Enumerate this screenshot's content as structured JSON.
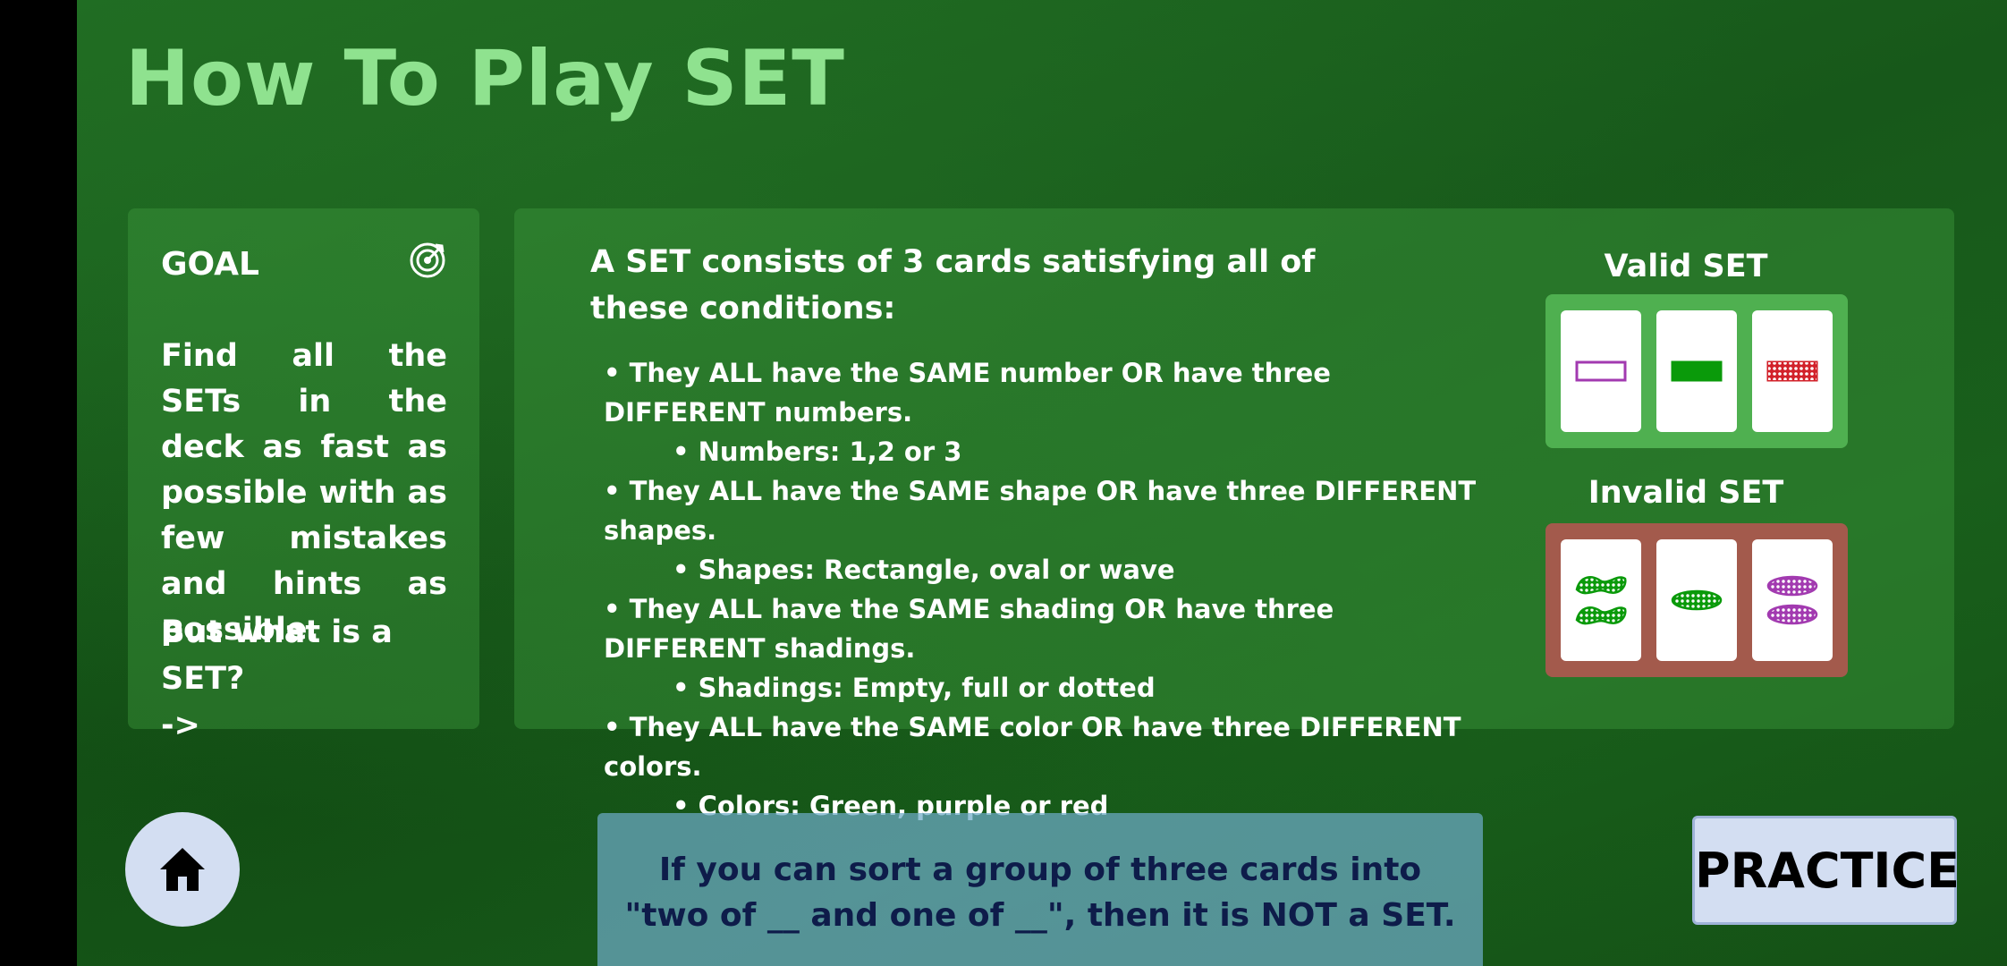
{
  "page": {
    "title": "How To Play SET"
  },
  "goal": {
    "heading": "GOAL",
    "icon": "target-icon",
    "text": "Find all the SETs in the deck as fast as possible with as few mistakes and hints as possible.",
    "question": "But what is a SET?",
    "arrow": "->"
  },
  "rules": {
    "intro": "A SET consists of 3 cards satisfying all of these conditions:",
    "items": [
      {
        "rule": "• They ALL have the SAME number OR have three DIFFERENT numbers.",
        "detail": "• Numbers: 1,2 or 3"
      },
      {
        "rule": "• They ALL have the SAME shape OR have three DIFFERENT shapes.",
        "detail": "• Shapes: Rectangle, oval or wave"
      },
      {
        "rule": "• They ALL have the SAME shading OR have three DIFFERENT shadings.",
        "detail": "• Shadings: Empty, full or dotted"
      },
      {
        "rule": "• They ALL have the SAME color OR have three DIFFERENT colors.",
        "detail": "• Colors: Green,  purple or red"
      }
    ]
  },
  "examples": {
    "valid_label": "Valid SET",
    "invalid_label": "Invalid SET",
    "valid_color": "#4fb050",
    "invalid_color": "#a35a4c"
  },
  "hint": {
    "line1": "If you can sort a group of three cards into",
    "line2": "\"two of __ and one of __\", then it is NOT a SET."
  },
  "buttons": {
    "home_icon": "home-icon",
    "practice": "PRACTICE"
  },
  "colors": {
    "title": "#8fe28f",
    "green": "#0a9a0a",
    "purple": "#a23ab0",
    "red": "#d2212a"
  }
}
